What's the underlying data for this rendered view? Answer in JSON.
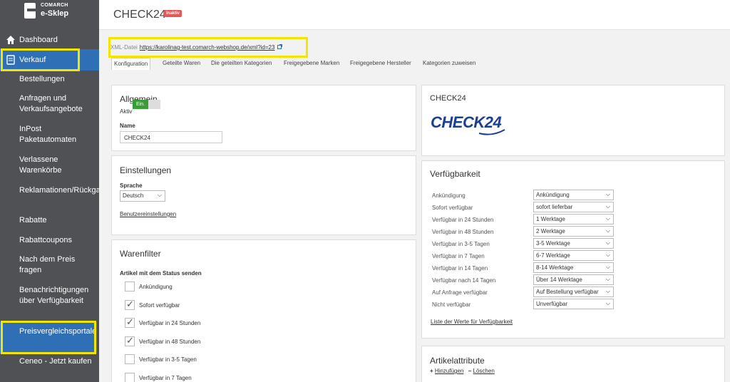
{
  "logo": {
    "line1": "COMARCH",
    "line2": "e-Sklep"
  },
  "sidebar": {
    "dashboard": "Dashboard",
    "verkauf": "Verkauf",
    "items": [
      "Bestellungen",
      "Anfragen und Verkaufsangebote",
      "InPost Paketautomaten",
      "Verlassene Warenkörbe",
      "Reklamationen/Rückgaben",
      "Rabatte",
      "Rabattcoupons",
      "Nach dem Preis fragen",
      "Benachrichtigungen über Verfügbarkeit",
      "Preisvergleichsportale",
      "Ceneo - Jetzt kaufen"
    ]
  },
  "page": {
    "title": "CHECK24",
    "badge": "Inaktiv"
  },
  "xml": {
    "label": "XML-Datei",
    "url": "https://karolinag-test.comarch-webshop.de/xml?id=23"
  },
  "tabs": [
    "Konfiguration",
    "Geteilte Waren",
    "Die geteilten Kategorien",
    "Freigegebene Marken",
    "Freigegebene Hersteller",
    "Kategorien zuweisen"
  ],
  "allgemein": {
    "title": "Allgemein",
    "aktiv_label": "Aktiv",
    "toggle_on": "Ein.",
    "name_label": "Name",
    "name_value": "CHECK24"
  },
  "einstellungen": {
    "title": "Einstellungen",
    "sprache_label": "Sprache",
    "sprache_value": "Deutsch",
    "link": "Benutzereinstellungen"
  },
  "warenfilter": {
    "title": "Warenfilter",
    "subtitle": "Artikel mit dem Status senden",
    "items": [
      {
        "label": "Ankündigung",
        "checked": false
      },
      {
        "label": "Sofort verfügbar",
        "checked": true
      },
      {
        "label": "Verfügbar in 24 Stunden",
        "checked": true
      },
      {
        "label": "Verfügbar in 48 Stunden",
        "checked": true
      },
      {
        "label": "Verfügbar in 3-5 Tagen",
        "checked": false
      },
      {
        "label": "Verfügbar in 7 Tagen",
        "checked": false
      }
    ]
  },
  "check24": {
    "title": "CHECK24",
    "logo_text": "CHECK24"
  },
  "verfuegbarkeit": {
    "title": "Verfügbarkeit",
    "rows": [
      {
        "label": "Ankündigung",
        "value": "Ankündigung"
      },
      {
        "label": "Sofort verfügbar",
        "value": "sofort lieferbar"
      },
      {
        "label": "Verfügbar in 24 Stunden",
        "value": "1 Werktage"
      },
      {
        "label": "Verfügbar in 48 Stunden",
        "value": "2 Werktage"
      },
      {
        "label": "Verfügbar in 3-5 Tagen",
        "value": "3-5 Werktage"
      },
      {
        "label": "Verfügbar in 7 Tagen",
        "value": "6-7 Werktage"
      },
      {
        "label": "Verfügbar in 14 Tagen",
        "value": "8-14 Werktage"
      },
      {
        "label": "Verfügbar nach 14 Tagen",
        "value": "Über 14 Werktage"
      },
      {
        "label": "Auf Anfrage verfügbar",
        "value": "Auf Bestellung verfügbar"
      },
      {
        "label": "Nicht verfügbar",
        "value": "Unverfügbar"
      }
    ],
    "link": "Liste der Werte für Verfügbarkeit"
  },
  "artikelattribute": {
    "title": "Artikelattribute",
    "add": "Hinzufügen",
    "delete": "Löschen"
  },
  "colors": {
    "sidebar_bg": "#505155",
    "active_bg": "#2f6fb6",
    "highlight": "#f2e600",
    "toggle_on": "#3a9d3a",
    "badge": "#e05a5a",
    "check24_logo": "#1d3f8f"
  }
}
